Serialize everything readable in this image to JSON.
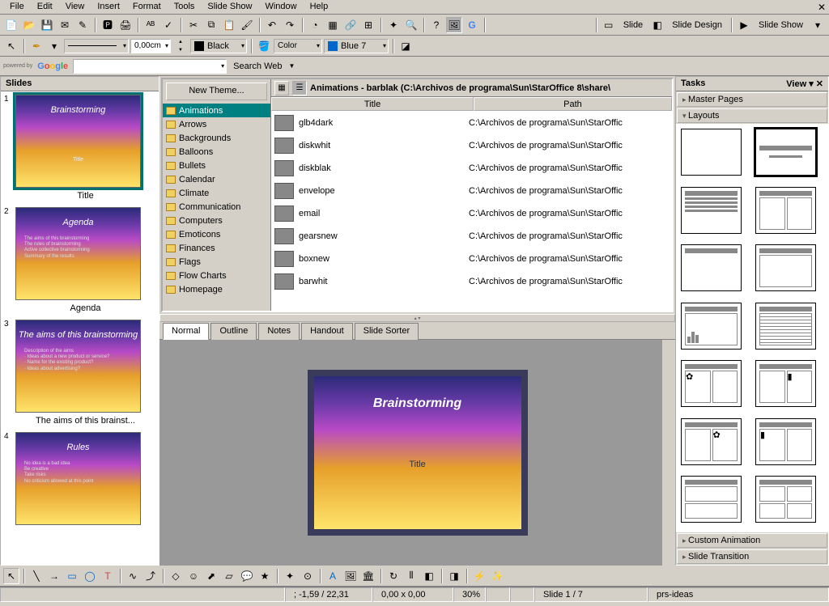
{
  "menu": [
    "File",
    "Edit",
    "View",
    "Insert",
    "Format",
    "Tools",
    "Slide Show",
    "Window",
    "Help"
  ],
  "toolbar2": {
    "width": "0,00cm",
    "color1": "Black",
    "color2": "Color",
    "color3": "Blue 7"
  },
  "google": {
    "poweredby": "powered by",
    "brand": "Google",
    "searchweb": "Search Web"
  },
  "rightbtns": {
    "slide": "Slide",
    "design": "Slide Design",
    "show": "Slide Show"
  },
  "slidepanel": {
    "title": "Slides",
    "slides": [
      {
        "n": "1",
        "title": "Brainstorming",
        "sub": "Title",
        "label": "Title"
      },
      {
        "n": "2",
        "title": "Agenda",
        "body": "The aims of this brainstorming\nThe rules of brainstorming\nActive collective brainstorming\nSummary of the results",
        "label": "Agenda"
      },
      {
        "n": "3",
        "title": "The aims of this brainstorming",
        "body": "Description of the aims\n· Ideas about a new product or service?\n· Name for the existing product?\n· Ideas about advertising?",
        "label": "The aims of this brainst..."
      },
      {
        "n": "4",
        "title": "Rules",
        "body": "No idea is a bad idea\nBe creative\nTake risks\nNo criticism allowed at this point",
        "label": ""
      }
    ]
  },
  "gallery": {
    "newtheme": "New Theme...",
    "themes": [
      "Animations",
      "Arrows",
      "Backgrounds",
      "Balloons",
      "Bullets",
      "Calendar",
      "Climate",
      "Communication",
      "Computers",
      "Emoticons",
      "Finances",
      "Flags",
      "Flow Charts",
      "Homepage"
    ],
    "sel": 0,
    "breadcrumb": "Animations - barblak (C:\\Archivos de programa\\Sun\\StarOffice 8\\share\\",
    "cols": {
      "title": "Title",
      "path": "Path"
    },
    "rows": [
      {
        "name": "glb4dark",
        "path": "C:\\Archivos de programa\\Sun\\StarOffic"
      },
      {
        "name": "diskwhit",
        "path": "C:\\Archivos de programa\\Sun\\StarOffic"
      },
      {
        "name": "diskblak",
        "path": "C:\\Archivos de programa\\Sun\\StarOffic"
      },
      {
        "name": "envelope",
        "path": "C:\\Archivos de programa\\Sun\\StarOffic"
      },
      {
        "name": "email",
        "path": "C:\\Archivos de programa\\Sun\\StarOffic"
      },
      {
        "name": "gearsnew",
        "path": "C:\\Archivos de programa\\Sun\\StarOffic"
      },
      {
        "name": "boxnew",
        "path": "C:\\Archivos de programa\\Sun\\StarOffic"
      },
      {
        "name": "barwhit",
        "path": "C:\\Archivos de programa\\Sun\\StarOffic"
      }
    ]
  },
  "tabs": [
    "Normal",
    "Outline",
    "Notes",
    "Handout",
    "Slide Sorter"
  ],
  "activeTab": 0,
  "editslide": {
    "title": "Brainstorming",
    "placeholder": "Title"
  },
  "tasks": {
    "hdr": "Tasks",
    "view": "View",
    "items": [
      "Master Pages",
      "Layouts",
      "Custom Animation",
      "Slide Transition"
    ]
  },
  "status": {
    "coord": "; -1,59 / 22,31",
    "size": "0,00 x 0,00",
    "zoom": "30%",
    "page": "Slide 1 / 7",
    "tpl": "prs-ideas"
  }
}
